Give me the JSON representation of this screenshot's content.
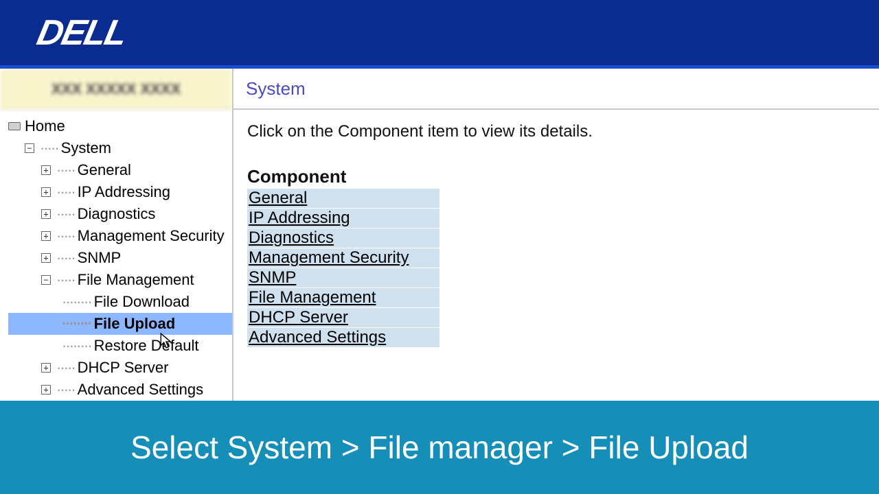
{
  "logo_text": "DELL",
  "device_label": "XXX XXXXX XXXX",
  "tree": {
    "home": "Home",
    "system": "System",
    "general": "General",
    "ip_addressing": "IP Addressing",
    "diagnostics": "Diagnostics",
    "mgmt_sec": "Management Security",
    "snmp": "SNMP",
    "file_mgmt": "File Management",
    "file_download": "File Download",
    "file_upload": "File Upload",
    "restore_default": "Restore Default",
    "dhcp_server": "DHCP Server",
    "adv_settings": "Advanced Settings"
  },
  "main": {
    "title": "System",
    "instruction": "Click on the Component item to view its details.",
    "component_heading": "Component",
    "components": [
      "General",
      "IP Addressing",
      "Diagnostics",
      "Management Security",
      "SNMP",
      "File Management",
      "DHCP Server",
      "Advanced Settings"
    ]
  },
  "banner": "Select System > File manager > File Upload"
}
